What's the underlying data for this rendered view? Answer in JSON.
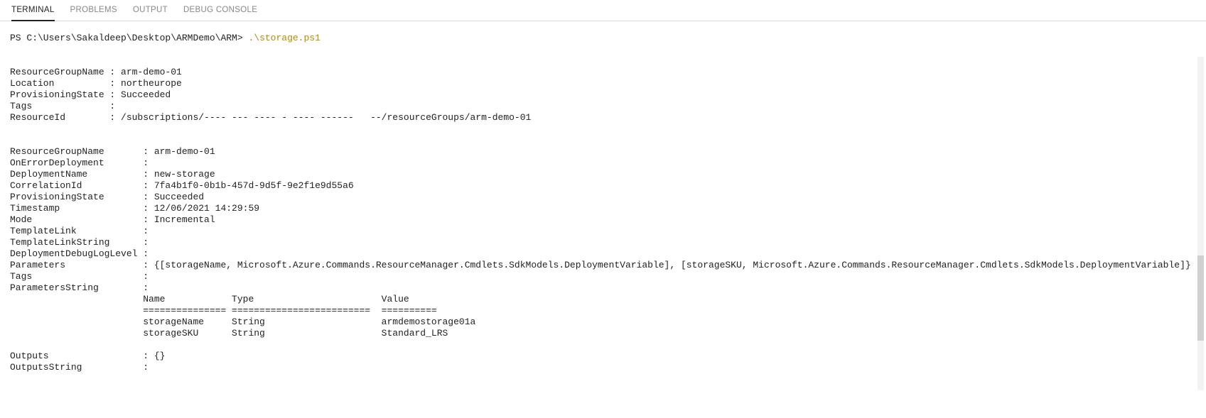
{
  "tabs": {
    "terminal": "TERMINAL",
    "problems": "PROBLEMS",
    "output": "OUTPUT",
    "debug": "DEBUG CONSOLE"
  },
  "prompt": {
    "cwd": "PS C:\\Users\\Sakaldeep\\Desktop\\ARMDemo\\ARM>",
    "cmd": ".\\storage.ps1"
  },
  "block1": {
    "ResourceGroupName": "arm-demo-01",
    "Location": "northeurope",
    "ProvisioningState": "Succeeded",
    "Tags": "",
    "ResourceId": "/subscriptions/---- --- ---- - ---- ------   --/resourceGroups/arm-demo-01"
  },
  "block2": {
    "ResourceGroupName": "arm-demo-01",
    "OnErrorDeployment": "",
    "DeploymentName": "new-storage",
    "CorrelationId": "7fa4b1f0-0b1b-457d-9d5f-9e2f1e9d55a6",
    "ProvisioningState": "Succeeded",
    "Timestamp": "12/06/2021 14:29:59",
    "Mode": "Incremental",
    "TemplateLink": "",
    "TemplateLinkString": "",
    "DeploymentDebugLogLevel": "",
    "Parameters": "{[storageName, Microsoft.Azure.Commands.ResourceManager.Cmdlets.SdkModels.DeploymentVariable], [storageSKU, Microsoft.Azure.Commands.ResourceManager.Cmdlets.SdkModels.DeploymentVariable]}",
    "Tags": "",
    "ParametersString": ""
  },
  "paramsTable": {
    "headers": {
      "c1": "Name",
      "c2": "Type",
      "c3": "Value"
    },
    "rules": {
      "c1": "===============",
      "c2": "=========================",
      "c3": "=========="
    },
    "rows": [
      {
        "c1": "storageName",
        "c2": "String",
        "c3": "armdemostorage01a"
      },
      {
        "c1": "storageSKU",
        "c2": "String",
        "c3": "Standard_LRS"
      }
    ]
  },
  "block3": {
    "Outputs": "{}",
    "OutputsString": ""
  },
  "colWidths": {
    "block1Key": 18,
    "block2Key": 24,
    "indent": 24,
    "p1": 16,
    "p2": 27,
    "p3": 20
  },
  "colon": ": "
}
